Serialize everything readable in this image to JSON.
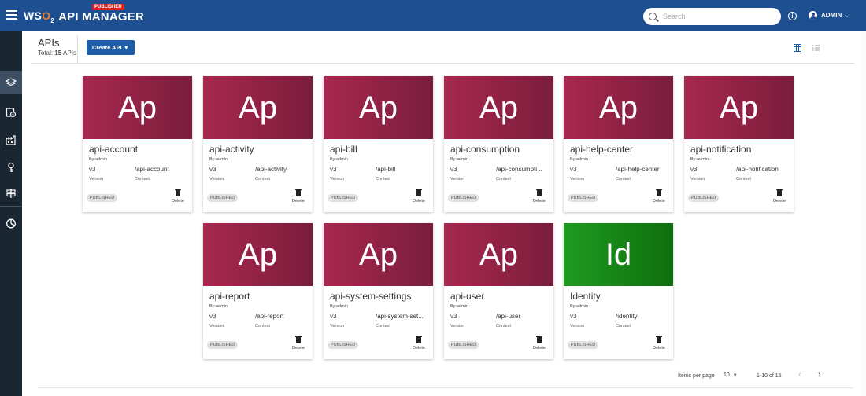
{
  "app": {
    "logo_text": "WSO2",
    "title": "API MANAGER",
    "badge": "PUBLISHER"
  },
  "search": {
    "placeholder": "Search"
  },
  "user": {
    "name": "ADMIN"
  },
  "header": {
    "title": "APIs",
    "total_label": "Total:",
    "total_count": "15",
    "total_suffix": "APIs",
    "create_button": "Create API ▼"
  },
  "sidebar": {
    "items": [
      {
        "icon": "layers-icon",
        "active": true
      },
      {
        "icon": "api-settings-icon",
        "active": false
      },
      {
        "icon": "factory-icon",
        "active": false
      },
      {
        "icon": "key-icon",
        "active": false
      },
      {
        "icon": "signpost-icon",
        "active": false
      },
      {
        "icon": "pie-chart-icon",
        "active": false
      }
    ]
  },
  "cards": [
    {
      "thumb": "Ap",
      "name": "api-account",
      "by": "By:admin",
      "version": "v3",
      "context": "/api-account",
      "version_label": "Version",
      "context_label": "Context",
      "status": "PUBLISHED",
      "delete_label": "Delete",
      "color": "#a8284f"
    },
    {
      "thumb": "Ap",
      "name": "api-activity",
      "by": "By:admin",
      "version": "v3",
      "context": "/api-activity",
      "version_label": "Version",
      "context_label": "Context",
      "status": "PUBLISHED",
      "delete_label": "Delete",
      "color": "#a8284f"
    },
    {
      "thumb": "Ap",
      "name": "api-bill",
      "by": "By:admin",
      "version": "v3",
      "context": "/api-bill",
      "version_label": "Version",
      "context_label": "Context",
      "status": "PUBLISHED",
      "delete_label": "Delete",
      "color": "#a8284f"
    },
    {
      "thumb": "Ap",
      "name": "api-consumption",
      "by": "By:admin",
      "version": "v3",
      "context": "/api-consumpti...",
      "version_label": "Version",
      "context_label": "Context",
      "status": "PUBLISHED",
      "delete_label": "Delete",
      "color": "#a8284f"
    },
    {
      "thumb": "Ap",
      "name": "api-help-center",
      "by": "By:admin",
      "version": "v3",
      "context": "/api-help-center",
      "version_label": "Version",
      "context_label": "Context",
      "status": "PUBLISHED",
      "delete_label": "Delete",
      "color": "#a8284f"
    },
    {
      "thumb": "Ap",
      "name": "api-notification",
      "by": "By:admin",
      "version": "v3",
      "context": "/api-notification",
      "version_label": "Version",
      "context_label": "Context",
      "status": "PUBLISHED",
      "delete_label": "Delete",
      "color": "#a8284f"
    },
    {
      "thumb": "Ap",
      "name": "api-report",
      "by": "By:admin",
      "version": "v3",
      "context": "/api-report",
      "version_label": "Version",
      "context_label": "Context",
      "status": "PUBLISHED",
      "delete_label": "Delete",
      "color": "#a8284f"
    },
    {
      "thumb": "Ap",
      "name": "api-system-settings",
      "by": "By:admin",
      "version": "v3",
      "context": "/api-system-set...",
      "version_label": "Version",
      "context_label": "Context",
      "status": "PUBLISHED",
      "delete_label": "Delete",
      "color": "#a8284f"
    },
    {
      "thumb": "Ap",
      "name": "api-user",
      "by": "By:admin",
      "version": "v3",
      "context": "/api-user",
      "version_label": "Version",
      "context_label": "Context",
      "status": "PUBLISHED",
      "delete_label": "Delete",
      "color": "#a8284f"
    },
    {
      "thumb": "Id",
      "name": "Identity",
      "by": "By:admin",
      "version": "v3",
      "context": "/identity",
      "version_label": "Version",
      "context_label": "Context",
      "status": "PUBLISHED",
      "delete_label": "Delete",
      "color": "#1f9a1f"
    }
  ],
  "pagination": {
    "items_per_page_label": "Items per page",
    "items_per_page": "10",
    "range": "1-10 of 15",
    "prev": "‹",
    "next": "›"
  }
}
